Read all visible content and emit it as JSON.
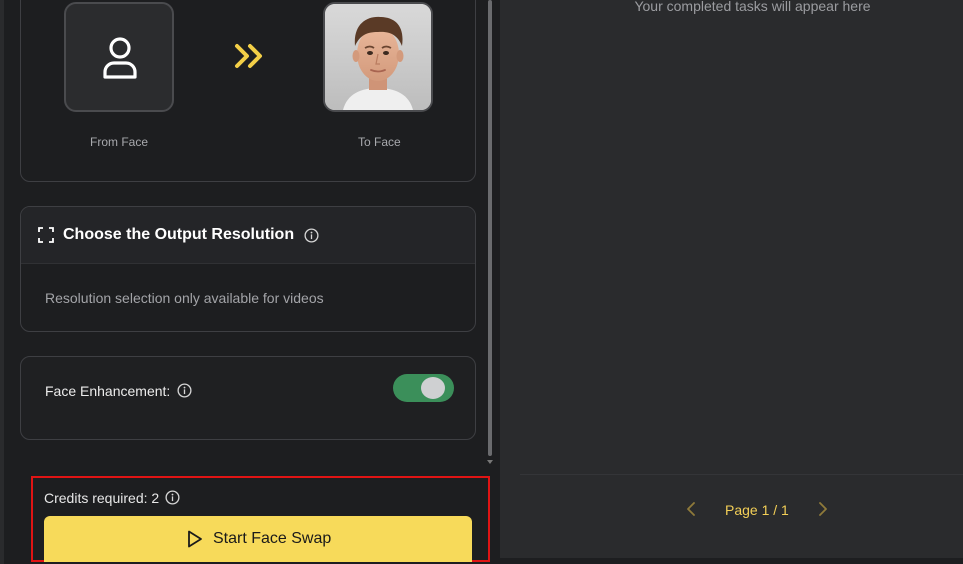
{
  "faces": {
    "from_label": "From Face",
    "to_label": "To Face"
  },
  "resolution": {
    "title": "Choose the Output Resolution",
    "description": "Resolution selection only available for videos"
  },
  "enhancement": {
    "label": "Face Enhancement:",
    "enabled": true
  },
  "footer": {
    "credits_text": "Credits required: 2",
    "start_label": "Start Face Swap"
  },
  "results": {
    "empty_message": "Your completed tasks will appear here",
    "page_label": "Page 1 / 1"
  },
  "colors": {
    "accent_yellow": "#f7da5a",
    "toggle_on": "#3b8f5a",
    "highlight_red": "#e01414"
  },
  "icons": [
    "user-icon",
    "double-chevron-right-icon",
    "expand-icon",
    "info-icon",
    "play-icon",
    "chevron-left-icon",
    "chevron-right-icon"
  ]
}
